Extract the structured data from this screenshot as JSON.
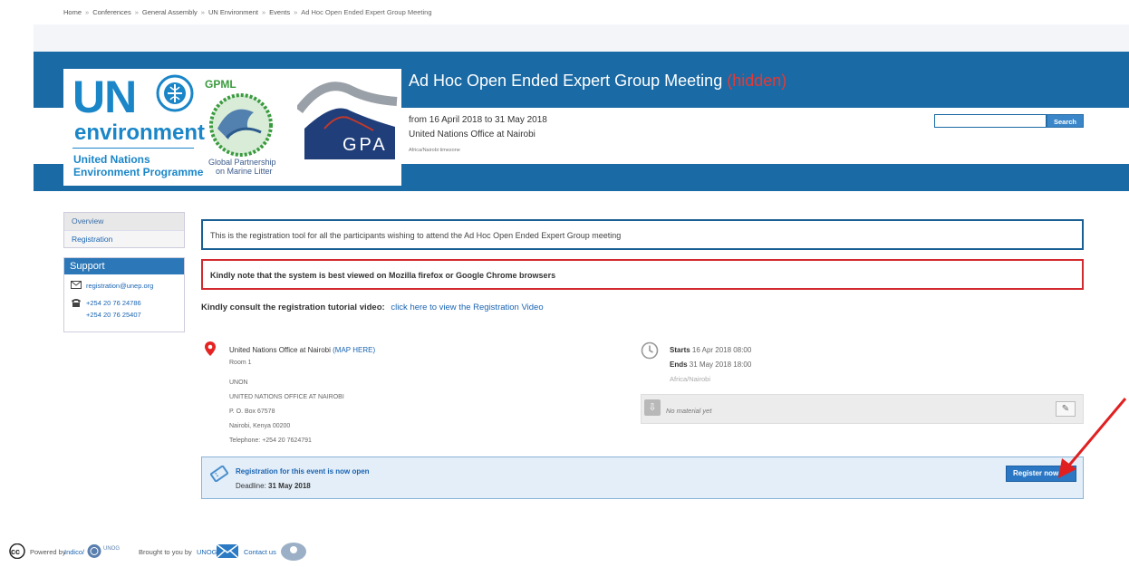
{
  "breadcrumb": {
    "items": [
      "Home",
      "Conferences",
      "General Assembly",
      "UN Environment",
      "Events",
      "Ad Hoc Open Ended Expert Group Meeting"
    ],
    "separator": "»"
  },
  "logo": {
    "un": "UN",
    "environment": "environment",
    "programme_line1": "United Nations",
    "programme_line2": "Environment Programme",
    "gpml": "GPML",
    "gpml_caption1": "Global Partnership",
    "gpml_caption2": "on Marine Litter",
    "gpa": "GPA"
  },
  "event": {
    "title": "Ad Hoc Open Ended Expert Group Meeting",
    "hidden_tag": "(hidden)",
    "dates": "from 16 April 2018 to 31 May 2018",
    "venue": "United Nations Office at Nairobi",
    "timezone": "Africa/Nairobi timezone"
  },
  "search": {
    "button_label": "Search",
    "value": ""
  },
  "menu": {
    "items": [
      {
        "label": "Overview"
      },
      {
        "label": "Registration"
      }
    ]
  },
  "support": {
    "title": "Support",
    "email": "registration@unep.org",
    "phone1": "+254 20 76 24786",
    "phone2": "+254 20 76 25407"
  },
  "notices": {
    "info": "This is the registration tool for all the participants wishing to attend the Ad Hoc Open Ended Expert Group meeting",
    "warning": "Kindly note that the system is best viewed on Mozilla firefox or Google Chrome browsers"
  },
  "consult": {
    "label": "Kindly consult the registration tutorial video:",
    "link": "click here to view the Registration Video"
  },
  "location": {
    "name": "United Nations Office at Nairobi",
    "map_link": "(MAP HERE)",
    "room": "Room 1",
    "address": [
      "UNON",
      "UNITED NATIONS OFFICE AT NAIROBI",
      "P. O. Box 67578",
      "Nairobi, Kenya 00200",
      "Telephone: +254 20 7624791"
    ]
  },
  "schedule": {
    "starts_label": "Starts",
    "starts_value": "16 Apr 2018 08:00",
    "ends_label": "Ends",
    "ends_value": "31 May 2018 18:00",
    "timezone": "Africa/Nairobi"
  },
  "material": {
    "text": "No material yet"
  },
  "registration": {
    "status": "Registration for this event is now open",
    "deadline_label": "Deadline:",
    "deadline_value": "31 May 2018",
    "button_label": "Register now"
  },
  "footer": {
    "powered_by": "Powered by",
    "indico": "Indico/",
    "unog_logo_text": "UNOG",
    "brought_by": "Brought to you by",
    "unog": "UNOG/",
    "contact": "Contact us"
  },
  "colors": {
    "header_blue": "#1a6aa5",
    "hidden_red": "#e53935",
    "notice_blue": "#1a5f93",
    "notice_red": "#d32a30",
    "link": "#1a64b2"
  }
}
